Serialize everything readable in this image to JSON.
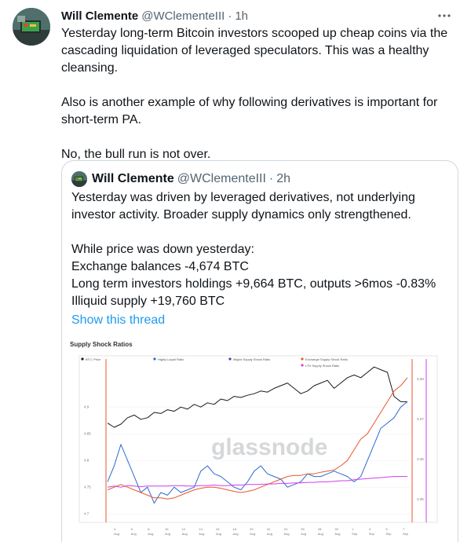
{
  "tweet": {
    "author_name": "Will Clemente",
    "author_handle": "@WClementeIII",
    "separator": "·",
    "time": "1h",
    "more_icon": "more-icon",
    "paragraphs": [
      "Yesterday long-term Bitcoin investors scooped up cheap coins via the cascading liquidation of leveraged speculators. This was a healthy cleansing.",
      "Also is another example of why following derivatives is important for short-term PA.",
      "No, the bull run is not over."
    ]
  },
  "quote": {
    "author_name": "Will Clemente",
    "author_handle": "@WClementeIII",
    "separator": "·",
    "time": "2h",
    "intro": "Yesterday was driven by leveraged derivatives, not underlying investor activity. Broader supply dynamics only strengthened.",
    "lines": [
      "While price was down yesterday:",
      "Exchange balances -4,674 BTC",
      "Long term investors holdings +9,664 BTC, outputs >6mos -0.83%",
      "Illiquid supply +19,760 BTC"
    ],
    "show_thread": "Show this thread"
  },
  "chart_data": {
    "type": "line",
    "title": "Supply Shock Ratios",
    "watermark": "glassnode",
    "legend": [
      {
        "label": "BTC: Price",
        "color": "#1a1a1a"
      },
      {
        "label": "Highly Liquid Ratio",
        "color": "#2a6cd1"
      },
      {
        "label": "Illiquid Supply Shock Ratio",
        "color": "#4a3fb8"
      },
      {
        "label": "Exchange Supply Shock Ratio",
        "color": "#e8572c"
      },
      {
        "label": "LTH Supply Shock Ratio",
        "color": "#d03df0"
      }
    ],
    "left_ticks": [
      "4.9",
      "4.85",
      "4.8",
      "4.75",
      "4.7"
    ],
    "right_ticks": [
      "3.28",
      "3.27",
      "3.26",
      "3.25"
    ],
    "x_ticks": [
      "4. Aug",
      "6. Aug",
      "8. Aug",
      "10. Aug",
      "12. Aug",
      "14. Aug",
      "16. Aug",
      "18. Aug",
      "20. Aug",
      "22. Aug",
      "24. Aug",
      "26. Aug",
      "28. Aug",
      "30. Aug",
      "1. Sep",
      "3. Sep",
      "5. Sep",
      "7. Sep"
    ],
    "series": [
      {
        "name": "BTC: Price",
        "color": "#1a1a1a",
        "values": [
          4.87,
          4.862,
          4.868,
          4.88,
          4.885,
          4.877,
          4.88,
          4.89,
          4.888,
          4.895,
          4.892,
          4.9,
          4.896,
          4.905,
          4.9,
          4.908,
          4.905,
          4.915,
          4.912,
          4.92,
          4.918,
          4.922,
          4.925,
          4.93,
          4.928,
          4.935,
          4.94,
          4.945,
          4.935,
          4.925,
          4.93,
          4.94,
          4.945,
          4.95,
          4.935,
          4.945,
          4.955,
          4.96,
          4.955,
          4.965,
          4.975,
          4.97,
          4.965,
          4.92,
          4.91,
          4.91
        ]
      },
      {
        "name": "Highly Liquid Ratio",
        "color": "#2a6cd1",
        "values": [
          4.76,
          4.79,
          4.83,
          4.8,
          4.77,
          4.74,
          4.75,
          4.72,
          4.74,
          4.735,
          4.75,
          4.74,
          4.745,
          4.75,
          4.78,
          4.79,
          4.775,
          4.77,
          4.76,
          4.75,
          4.745,
          4.76,
          4.78,
          4.79,
          4.775,
          4.77,
          4.765,
          4.75,
          4.755,
          4.76,
          4.775,
          4.77,
          4.77,
          4.775,
          4.78,
          4.775,
          4.77,
          4.76,
          4.77,
          4.8,
          4.83,
          4.86,
          4.87,
          4.88,
          4.9,
          4.91
        ]
      },
      {
        "name": "Exchange Supply Shock Ratio",
        "color": "#e8572c",
        "values": [
          4.745,
          4.75,
          4.755,
          4.75,
          4.745,
          4.74,
          4.735,
          4.73,
          4.73,
          4.728,
          4.73,
          4.735,
          4.74,
          4.745,
          4.748,
          4.75,
          4.75,
          4.748,
          4.745,
          4.742,
          4.74,
          4.742,
          4.745,
          4.75,
          4.755,
          4.76,
          4.765,
          4.77,
          4.772,
          4.772,
          4.775,
          4.775,
          4.778,
          4.78,
          4.782,
          4.79,
          4.8,
          4.82,
          4.84,
          4.85,
          4.87,
          4.89,
          4.91,
          4.93,
          4.94,
          4.955
        ]
      },
      {
        "name": "LTH Supply Shock Ratio",
        "color": "#d03df0",
        "values": [
          4.75,
          4.752,
          4.75,
          4.753,
          4.752,
          4.751,
          4.752,
          4.752,
          4.752,
          4.752,
          4.753,
          4.753,
          4.752,
          4.752,
          4.753,
          4.753,
          4.754,
          4.753,
          4.753,
          4.754,
          4.754,
          4.755,
          4.755,
          4.755,
          4.756,
          4.756,
          4.757,
          4.757,
          4.758,
          4.758,
          4.759,
          4.759,
          4.76,
          4.76,
          4.761,
          4.762,
          4.762,
          4.764,
          4.765,
          4.766,
          4.767,
          4.768,
          4.769,
          4.77,
          4.77,
          4.77
        ]
      }
    ],
    "ylim": [
      4.69,
      4.99
    ],
    "grid": true,
    "legend_position": "top"
  }
}
